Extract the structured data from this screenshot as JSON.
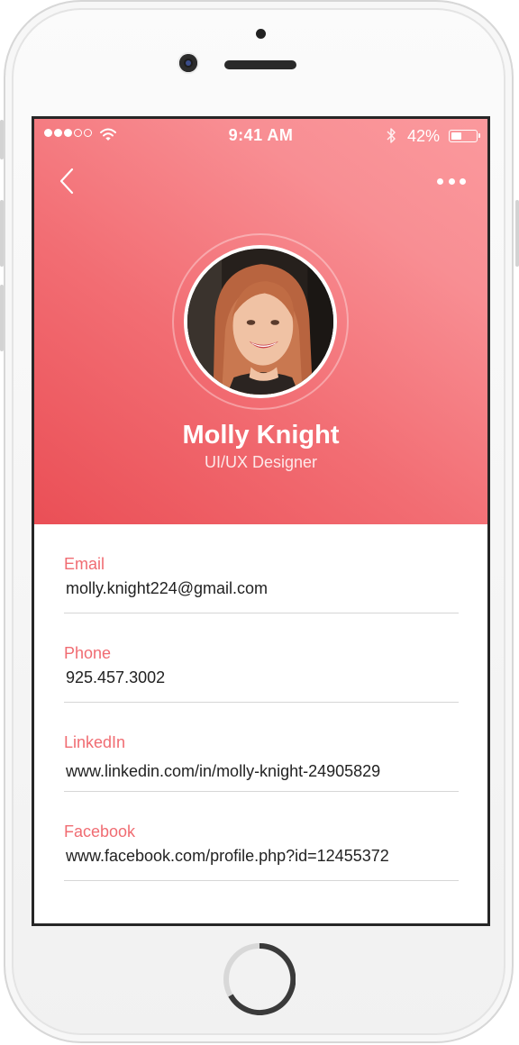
{
  "status_bar": {
    "time": "9:41 AM",
    "battery_percent": "42%",
    "battery_level": 0.42,
    "signal_bars_filled": 3,
    "signal_bars_total": 5
  },
  "nav": {
    "back_icon": "chevron-left-icon",
    "more_icon": "more-horizontal-icon"
  },
  "profile": {
    "name": "Molly Knight",
    "role": "UI/UX Designer"
  },
  "fields": [
    {
      "label": "Email",
      "value": "molly.knight224@gmail.com"
    },
    {
      "label": "Phone",
      "value": "925.457.3002"
    },
    {
      "label": "LinkedIn",
      "value": "www.linkedin.com/in/molly-knight-24905829"
    },
    {
      "label": "Facebook",
      "value": "www.facebook.com/profile.php?id=12455372"
    }
  ],
  "colors": {
    "header_gradient_start": "#ea4f56",
    "header_gradient_end": "#fb999d",
    "label_accent": "#f06c72",
    "value_text": "#222222",
    "divider": "#d6d6d6"
  }
}
